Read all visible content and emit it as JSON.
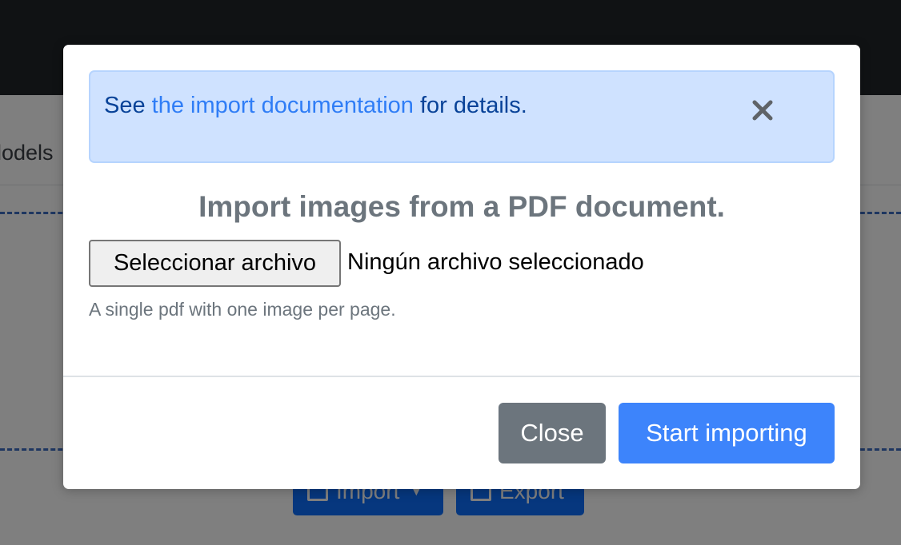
{
  "background": {
    "tab_fragment": "lodels",
    "import_label": "Import",
    "export_label": "Export"
  },
  "modal": {
    "alert": {
      "prefix": "See ",
      "link": "the import documentation",
      "suffix": " for details."
    },
    "title": "Import images from a PDF document.",
    "file_button": "Seleccionar archivo",
    "file_status": "Ningún archivo seleccionado",
    "help_text": "A single pdf with one image per page.",
    "close_label": "Close",
    "start_label": "Start importing"
  },
  "colors": {
    "primary": "#0d6efd",
    "secondary": "#6c757d",
    "alert_bg": "#cfe2ff",
    "navbar": "#212529"
  }
}
